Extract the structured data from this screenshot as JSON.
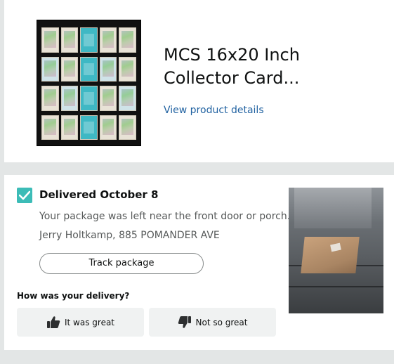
{
  "product": {
    "title": "MCS 16x20 Inch Collector Card...",
    "view_details_label": "View product details",
    "image_icon": "card-display-frame"
  },
  "delivery": {
    "status": "Delivered October 8",
    "message": "Your package was left near the front door or porch.",
    "address": "Jerry Holtkamp, 885 POMANDER AVE",
    "track_label": "Track package",
    "feedback_question": "How was your delivery?",
    "feedback_great_label": "It was great",
    "feedback_not_label": "Not so great",
    "photo_icon": "delivery-photo"
  },
  "colors": {
    "check_accent": "#3cbcb7",
    "link": "#2162a1"
  }
}
